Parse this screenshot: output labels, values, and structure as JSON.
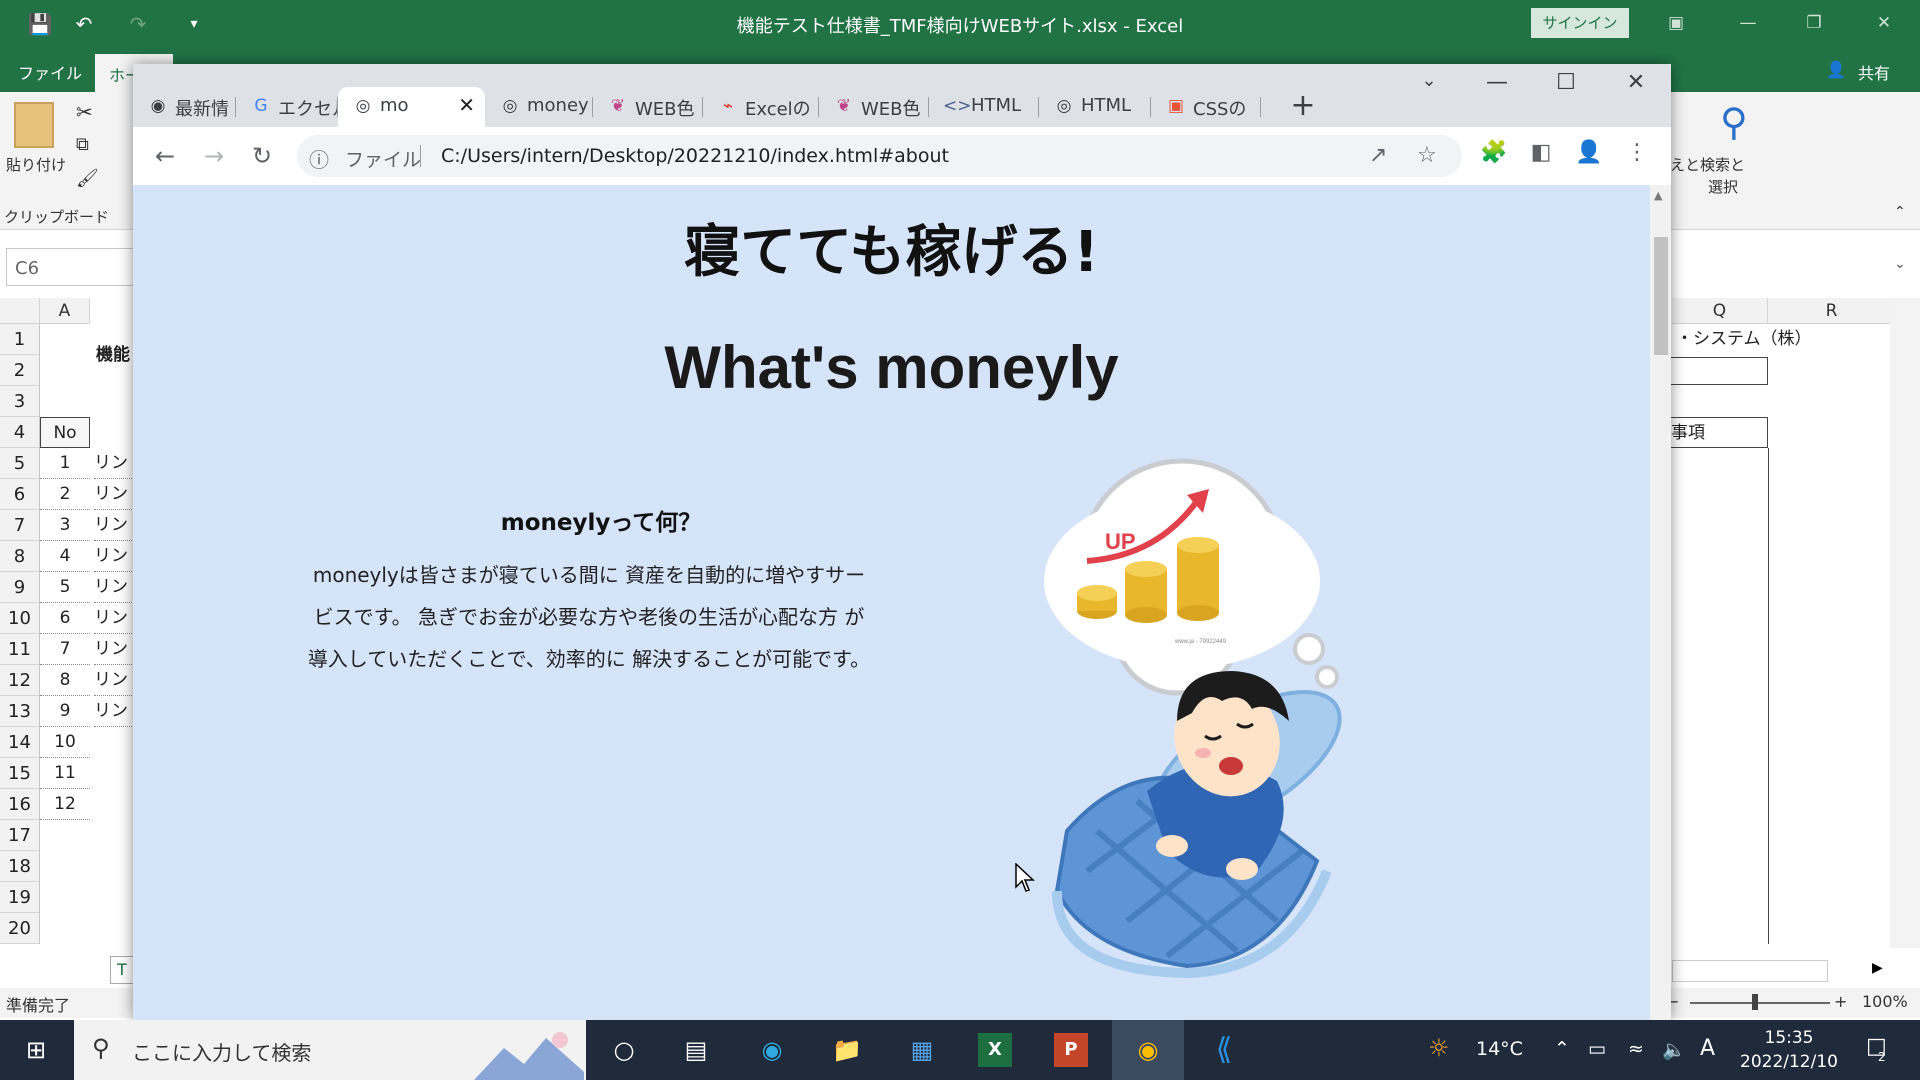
{
  "excel": {
    "title": "機能テスト仕様書_TMF様向けWEBサイト.xlsx  -  Excel",
    "signin": "サインイン",
    "tabs": {
      "file": "ファイル",
      "home": "ホーム",
      "share": "共有"
    },
    "ribbon": {
      "paste": "貼り付け",
      "clipboard": "クリップボード",
      "find_select_1": "検索と",
      "find_select_2": "選択",
      "partial_label": "えと"
    },
    "name_box": "C6",
    "columns": [
      "A",
      "Q",
      "R"
    ],
    "rows": [
      "1",
      "2",
      "3",
      "4",
      "5",
      "6",
      "7",
      "8",
      "9",
      "10",
      "11",
      "12",
      "13",
      "14",
      "15",
      "16",
      "17",
      "18",
      "19",
      "20"
    ],
    "cells": {
      "b1": "機能",
      "a4": "No",
      "a5_a16": [
        "1",
        "2",
        "3",
        "4",
        "5",
        "6",
        "7",
        "8",
        "9",
        "10",
        "11",
        "12"
      ],
      "b_partial": "リン",
      "q1": "・システム（株）",
      "q4": "事項"
    },
    "sheet_tab": "T",
    "status": "準備完了",
    "zoom": "100%"
  },
  "chrome": {
    "tabs": [
      {
        "label": "最新情",
        "icon": "chrome-icon"
      },
      {
        "label": "エクセル",
        "icon": "google-icon"
      },
      {
        "label": "mo",
        "icon": "globe-icon",
        "active": true
      },
      {
        "label": "money",
        "icon": "globe-icon"
      },
      {
        "label": "WEB色",
        "icon": "web-icon"
      },
      {
        "label": "Excelの",
        "icon": "pdf-icon"
      },
      {
        "label": "WEB色",
        "icon": "web-icon"
      },
      {
        "label": "HTML",
        "icon": "code-icon"
      },
      {
        "label": "HTML",
        "icon": "globe-icon"
      },
      {
        "label": "CSSの",
        "icon": "css-icon"
      }
    ],
    "omnibox": {
      "scheme": "ファイル",
      "url": "C:/Users/intern/Desktop/20221210/index.html#about"
    }
  },
  "page": {
    "hero": "寝てても稼げる!",
    "heading": "What's moneyly",
    "subheading": "moneylyって何？",
    "description": "moneylyは皆さまが寝ている間に 資産を自動的に増やすサービスです。 急ぎでお金が必要な方や老後の生活が心配な方 が導入していただくことで、効率的に 解決することが可能です。",
    "illustration": {
      "badge": "UP",
      "credit": "www.ja - 79922449"
    }
  },
  "taskbar": {
    "search_placeholder": "ここに入力して検索",
    "weather": "14°C",
    "ime": "A",
    "time": "15:35",
    "date": "2022/12/10",
    "notifications": "2"
  }
}
